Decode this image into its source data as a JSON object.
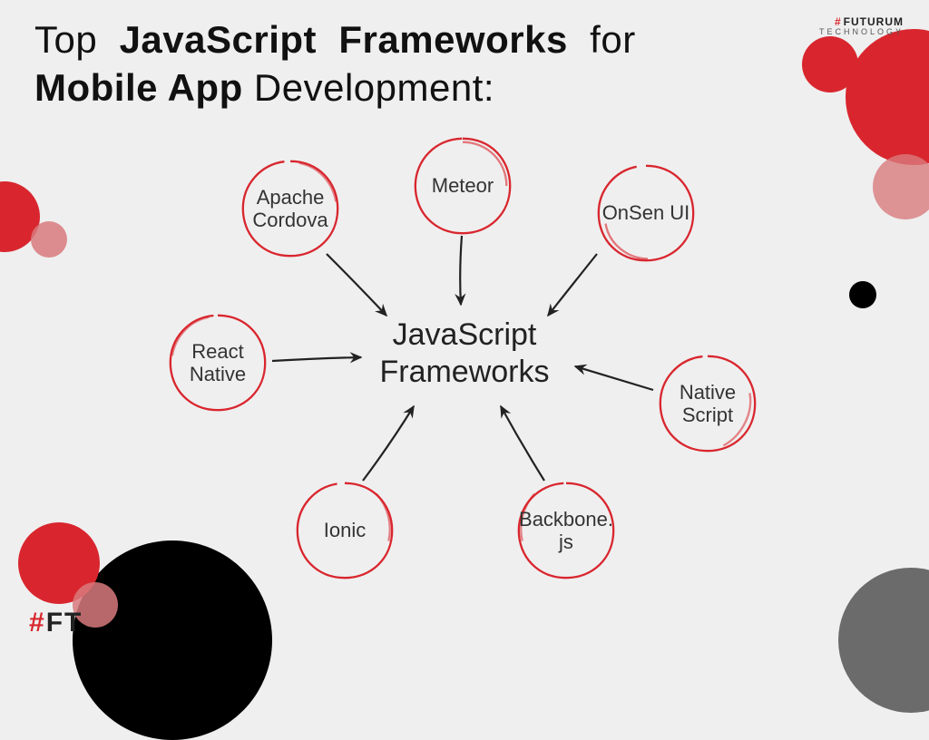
{
  "title": {
    "w1": "Top",
    "w2": "JavaScript",
    "w3": "Frameworks",
    "w4": "for",
    "w5": "Mobile App",
    "w6": "Development:"
  },
  "brand_top": {
    "hash": "#",
    "name": "FUTURUM",
    "sub": "TECHNOLOGY"
  },
  "brand_bl": {
    "hash": "#",
    "name": "FT"
  },
  "center": {
    "line1": "JavaScript",
    "line2": "Frameworks"
  },
  "nodes": {
    "meteor": "Meteor",
    "onsen": "OnSen UI",
    "native_script": "Native\nScript",
    "backbone": "Backbone.\njs",
    "ionic": "Ionic",
    "react_native": "React\nNative",
    "apache": "Apache\nCordova"
  }
}
